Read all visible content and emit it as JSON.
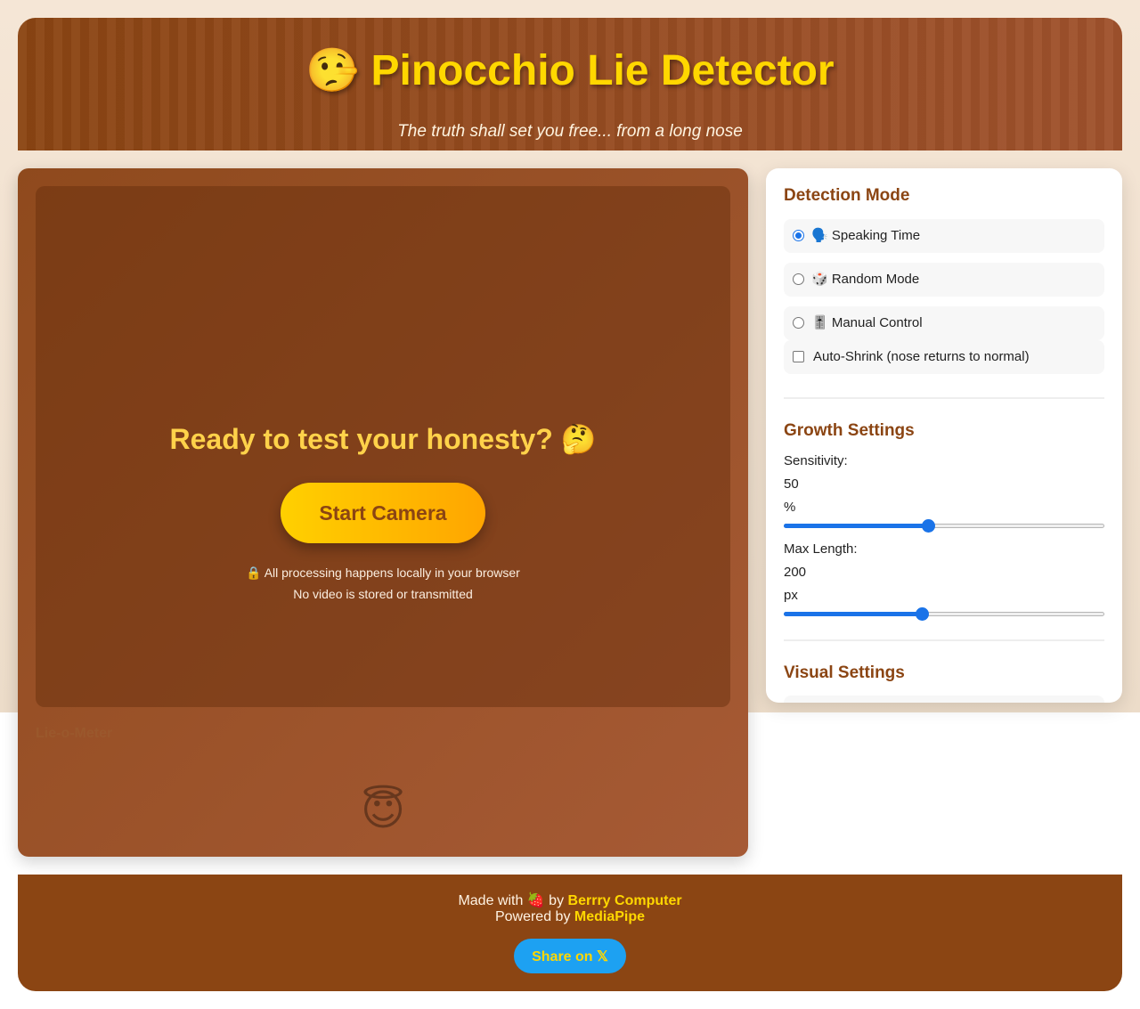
{
  "header": {
    "title": "🤥 Pinocchio Lie Detector",
    "subtitle": "The truth shall set you free... from a long nose"
  },
  "main": {
    "ready_title": "Ready to test your honesty? 🤔",
    "start_button": "Start Camera",
    "privacy_line1": "🔒 All processing happens locally in your browser",
    "privacy_line2": "No video is stored or transmitted",
    "meter_label": "Lie-o-Meter",
    "meter_emoji": "😇"
  },
  "side": {
    "detection_title": "Detection Mode",
    "modes": [
      {
        "label": "🗣️ Speaking Time",
        "checked": true
      },
      {
        "label": "🎲 Random Mode",
        "checked": false
      },
      {
        "label": "🎚️ Manual Control",
        "checked": false
      }
    ],
    "auto_shrink": "Auto-Shrink (nose returns to normal)",
    "growth_title": "Growth Settings",
    "sensitivity": {
      "label": "Sensitivity:",
      "value": "50",
      "unit": "%",
      "min": 0,
      "max": 100,
      "current": 45
    },
    "max_length": {
      "label": "Max Length:",
      "value": "200",
      "unit": "px",
      "min": 0,
      "max": 100,
      "current": 43
    },
    "visual_title": "Visual Settings"
  },
  "footer": {
    "made_with": "Made with 🍓 by",
    "made_link": "Berrry Computer",
    "powered_by": "Powered by",
    "powered_link": "MediaPipe",
    "share_button": "Share on 𝕏"
  },
  "colors": {
    "brand_brown": "#8b4513",
    "accent_gold": "#ffd700",
    "slider_blue": "#1a73e8",
    "share_blue": "#1da1f2"
  }
}
